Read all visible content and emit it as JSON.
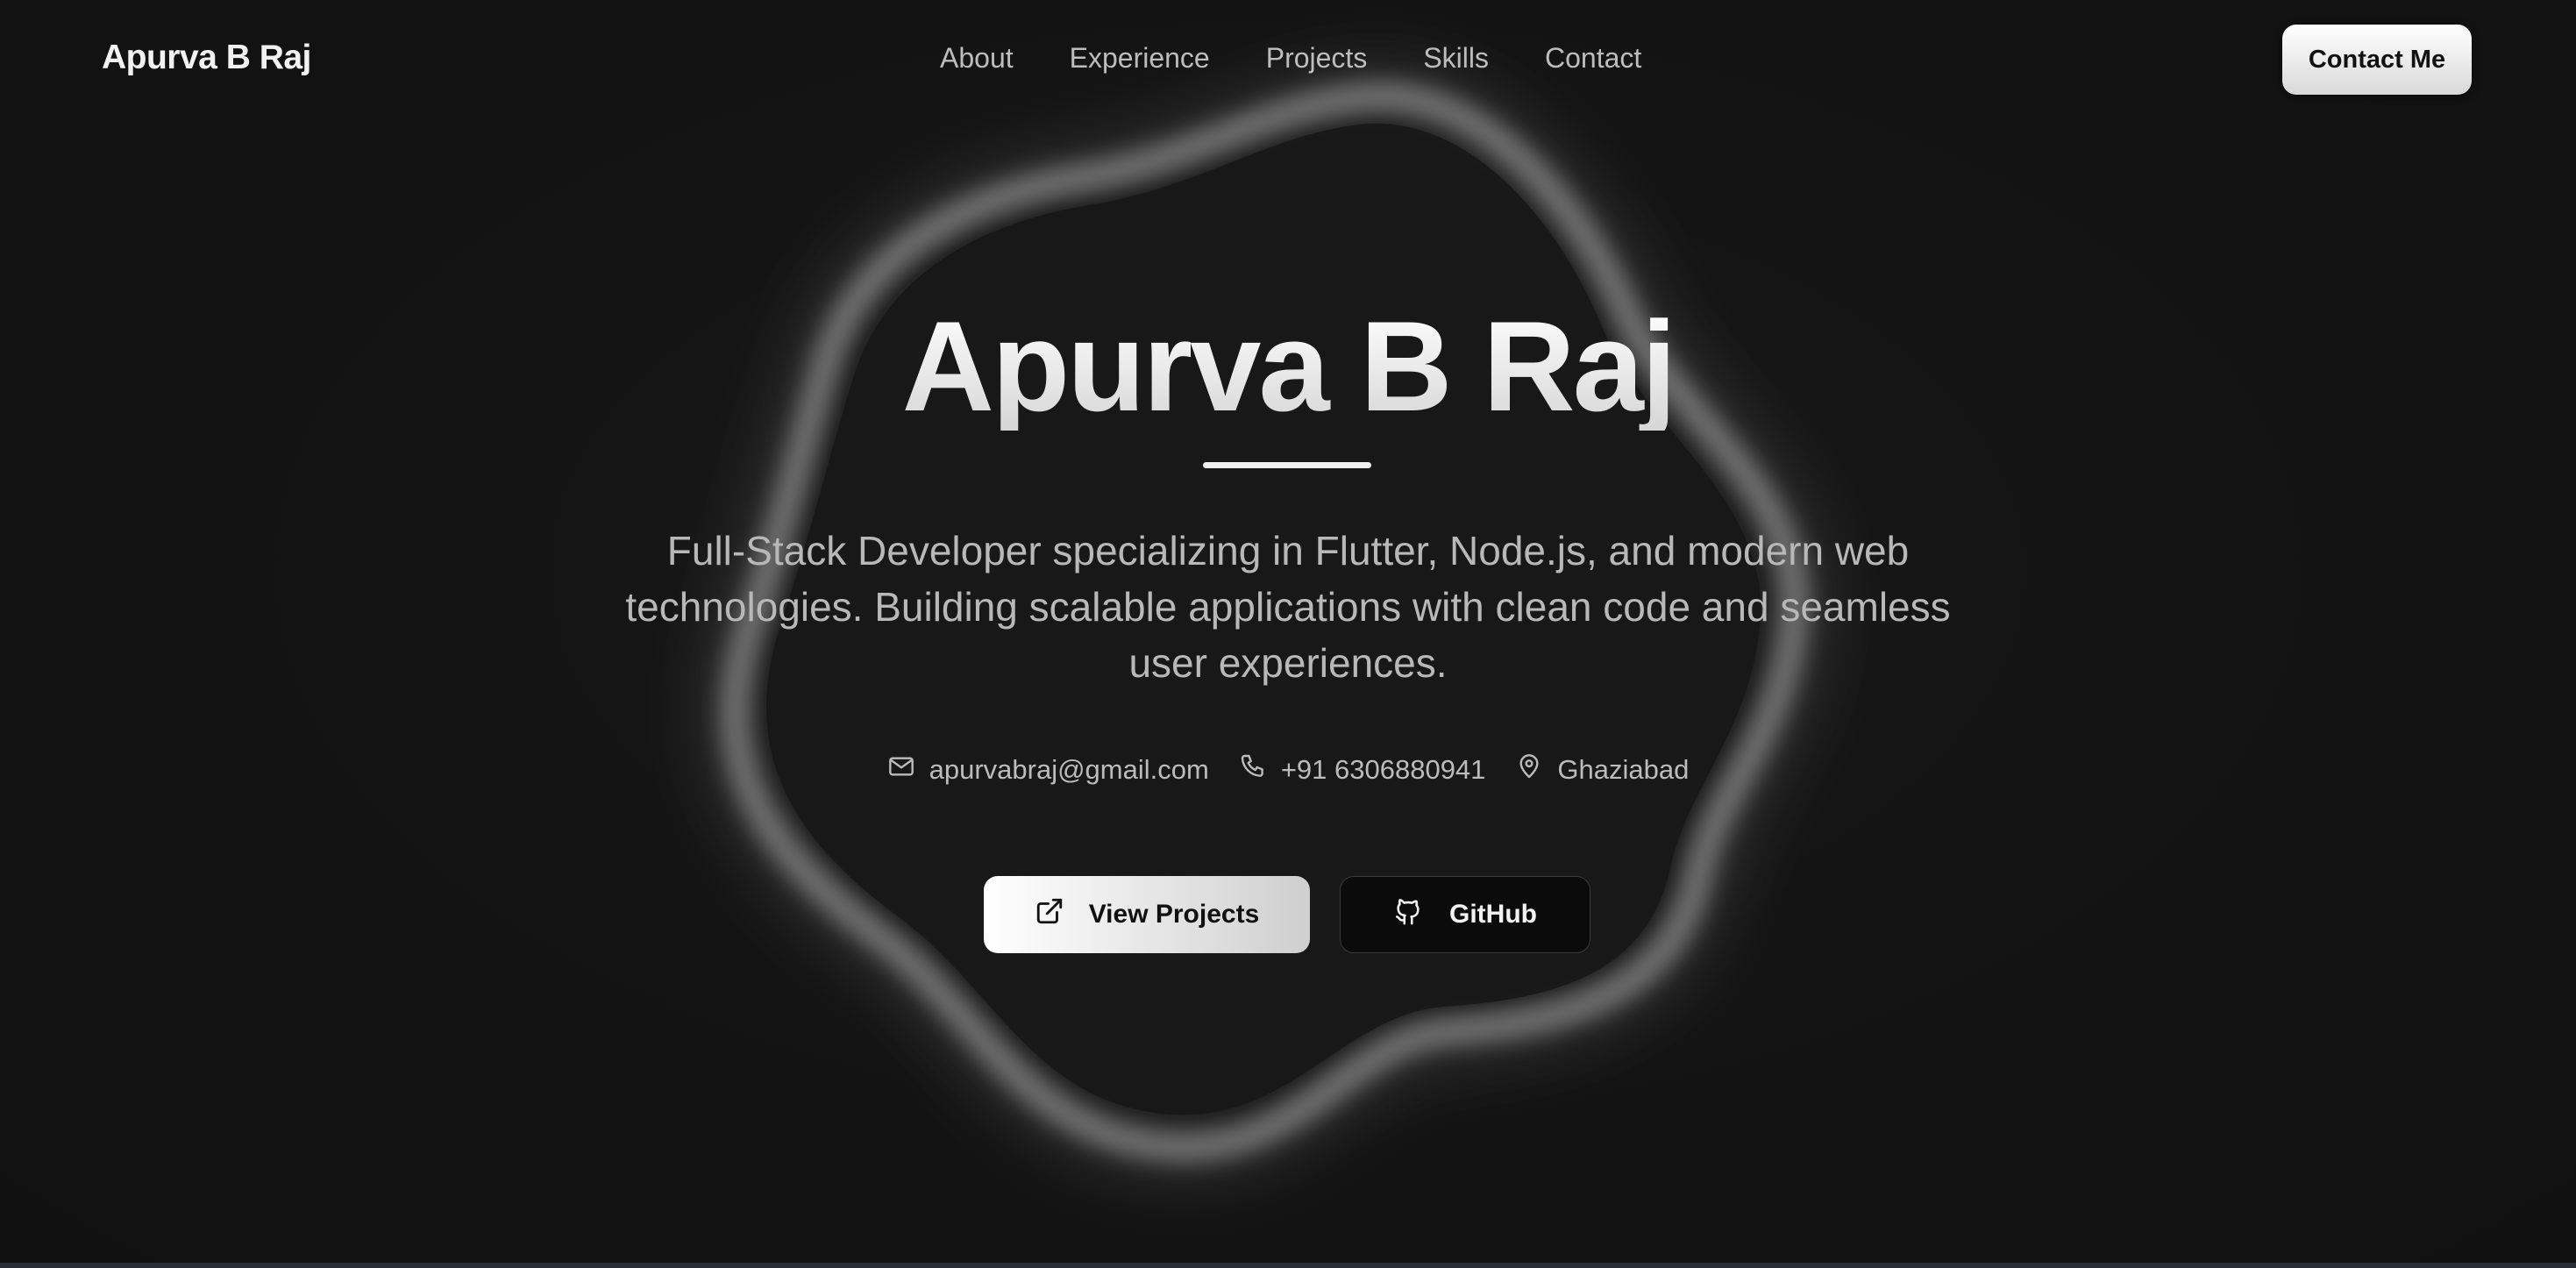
{
  "nav": {
    "brand": "Apurva B Raj",
    "links": [
      "About",
      "Experience",
      "Projects",
      "Skills",
      "Contact"
    ],
    "cta_label": "Contact Me"
  },
  "hero": {
    "title": "Apurva B Raj",
    "description": "Full-Stack Developer specializing in Flutter, Node.js, and modern web technologies. Building scalable applications with clean code and seamless user experiences.",
    "contacts": {
      "email": "apurvabraj@gmail.com",
      "phone": "+91 6306880941",
      "location": "Ghaziabad"
    },
    "contact_icons": [
      "mail-icon",
      "phone-icon",
      "map-pin-icon"
    ],
    "primary_button": {
      "label": "View Projects",
      "icon": "external-link-icon"
    },
    "secondary_button": {
      "label": "GitHub",
      "icon": "github-icon"
    }
  },
  "colors": {
    "background": "#131313",
    "text": "#f0f0f0",
    "muted_text": "#b8b8b8",
    "button_light": "#ffffff",
    "button_dark": "#0b0b0b"
  }
}
